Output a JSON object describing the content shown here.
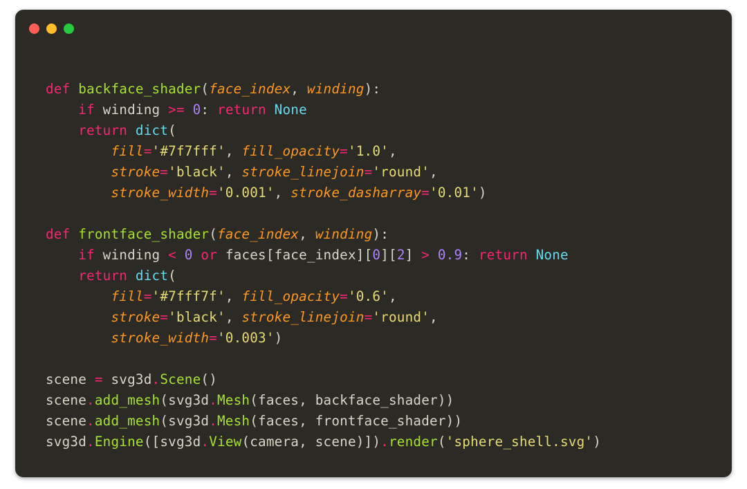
{
  "code": {
    "l1": {
      "kw_def": "def",
      "fn": "backface_shader",
      "open": "(",
      "p1": "face_index",
      "c": ", ",
      "p2": "winding",
      "close": "):"
    },
    "l2": {
      "kw_if": "if",
      "var": " winding ",
      "op": ">=",
      "num": " 0",
      "colon": ": ",
      "kw_ret": "return",
      "none": " None"
    },
    "l3": {
      "kw_ret": "return",
      "sp": " ",
      "dict": "dict",
      "open": "("
    },
    "l4": {
      "k1": "fill",
      "eq": "=",
      "s1": "'#7f7fff'",
      "c": ", ",
      "k2": "fill_opacity",
      "s2": "'1.0'",
      "end": ","
    },
    "l5": {
      "k1": "stroke",
      "eq": "=",
      "s1": "'black'",
      "c": ", ",
      "k2": "stroke_linejoin",
      "s2": "'round'",
      "end": ","
    },
    "l6": {
      "k1": "stroke_width",
      "eq": "=",
      "s1": "'0.001'",
      "c": ", ",
      "k2": "stroke_dasharray",
      "s2": "'0.01'",
      "end": ")"
    },
    "l8": {
      "kw_def": "def",
      "fn": "frontface_shader",
      "open": "(",
      "p1": "face_index",
      "c": ", ",
      "p2": "winding",
      "close": "):"
    },
    "l9": {
      "kw_if": "if",
      "var1": " winding ",
      "op1": "<",
      "num1": " 0 ",
      "kw_or": "or",
      "var2": " faces[face_index][",
      "idx0": "0",
      "br1": "][",
      "idx2": "2",
      "br2": "] ",
      "op2": ">",
      "num2": " 0.9",
      "colon": ": ",
      "kw_ret": "return",
      "none": " None"
    },
    "l10": {
      "kw_ret": "return",
      "sp": " ",
      "dict": "dict",
      "open": "("
    },
    "l11": {
      "k1": "fill",
      "eq": "=",
      "s1": "'#7fff7f'",
      "c": ", ",
      "k2": "fill_opacity",
      "s2": "'0.6'",
      "end": ","
    },
    "l12": {
      "k1": "stroke",
      "eq": "=",
      "s1": "'black'",
      "c": ", ",
      "k2": "stroke_linejoin",
      "s2": "'round'",
      "end": ","
    },
    "l13": {
      "k1": "stroke_width",
      "eq": "=",
      "s1": "'0.003'",
      "end": ")"
    },
    "l15": {
      "lhs": "scene ",
      "eq": "=",
      "mod": " svg3d",
      "dot": ".",
      "call": "Scene",
      "args": "()"
    },
    "l16": {
      "obj": "scene",
      "dot1": ".",
      "m": "add_mesh",
      "open": "(",
      "mod": "svg3d",
      "dot2": ".",
      "cls": "Mesh",
      "args": "(faces, backface_shader))"
    },
    "l17": {
      "obj": "scene",
      "dot1": ".",
      "m": "add_mesh",
      "open": "(",
      "mod": "svg3d",
      "dot2": ".",
      "cls": "Mesh",
      "args": "(faces, frontface_shader))"
    },
    "l18": {
      "mod1": "svg3d",
      "dot1": ".",
      "cls1": "Engine",
      "open": "([",
      "mod2": "svg3d",
      "dot2": ".",
      "cls2": "View",
      "args": "(camera, scene)])",
      "dot3": ".",
      "m": "render",
      "open2": "(",
      "s": "'sphere_shell.svg'",
      "close": ")"
    }
  }
}
